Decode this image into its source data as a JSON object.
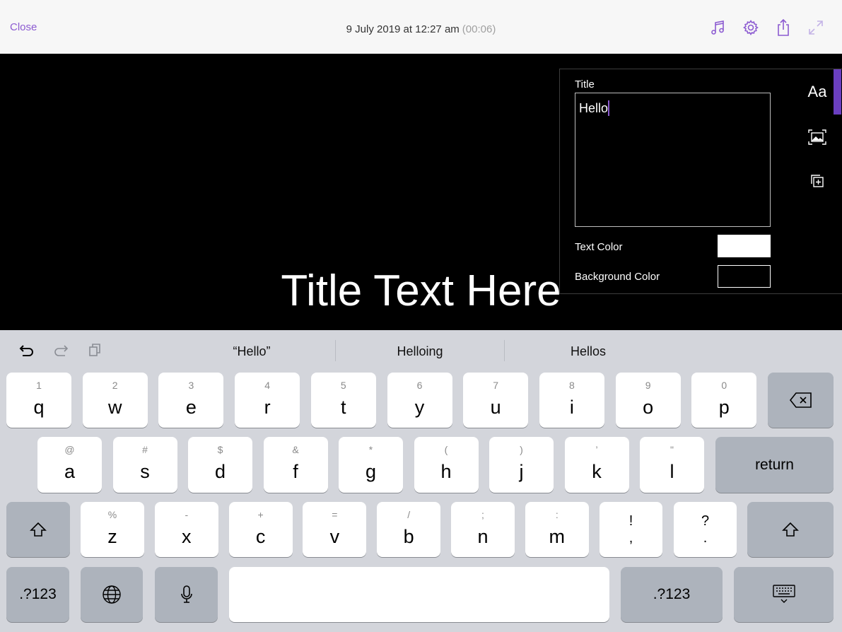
{
  "topbar": {
    "close_label": "Close",
    "timestamp": "9 July 2019 at 12:27 am",
    "duration": "(00:06)",
    "icons": [
      "music-icon",
      "gear-icon",
      "share-icon",
      "expand-icon"
    ]
  },
  "stage": {
    "title_text": "Title Text Here"
  },
  "panel": {
    "title_label": "Title",
    "title_value": "Hello",
    "text_color_label": "Text Color",
    "background_color_label": "Background Color",
    "text_color": "#ffffff",
    "background_color": "#000000",
    "tools": {
      "font_label": "Aa",
      "icons": [
        "font-icon",
        "image-frame-icon",
        "duplicate-add-icon"
      ]
    }
  },
  "keyboard": {
    "suggestions": [
      "“Hello”",
      "Helloing",
      "Hellos"
    ],
    "row1": [
      {
        "sub": "1",
        "main": "q"
      },
      {
        "sub": "2",
        "main": "w"
      },
      {
        "sub": "3",
        "main": "e"
      },
      {
        "sub": "4",
        "main": "r"
      },
      {
        "sub": "5",
        "main": "t"
      },
      {
        "sub": "6",
        "main": "y"
      },
      {
        "sub": "7",
        "main": "u"
      },
      {
        "sub": "8",
        "main": "i"
      },
      {
        "sub": "9",
        "main": "o"
      },
      {
        "sub": "0",
        "main": "p"
      }
    ],
    "row2": [
      {
        "sub": "@",
        "main": "a"
      },
      {
        "sub": "#",
        "main": "s"
      },
      {
        "sub": "$",
        "main": "d"
      },
      {
        "sub": "&",
        "main": "f"
      },
      {
        "sub": "*",
        "main": "g"
      },
      {
        "sub": "(",
        "main": "h"
      },
      {
        "sub": ")",
        "main": "j"
      },
      {
        "sub": "’",
        "main": "k"
      },
      {
        "sub": "\"",
        "main": "l"
      }
    ],
    "row3": [
      {
        "sub": "%",
        "main": "z"
      },
      {
        "sub": "-",
        "main": "x"
      },
      {
        "sub": "+",
        "main": "c"
      },
      {
        "sub": "=",
        "main": "v"
      },
      {
        "sub": "/",
        "main": "b"
      },
      {
        "sub": ";",
        "main": "n"
      },
      {
        "sub": ":",
        "main": "m"
      }
    ],
    "row3_punct": [
      {
        "top": "!",
        "bot": ","
      },
      {
        "top": "?",
        "bot": "."
      }
    ],
    "return_label": "return",
    "numbers_label": ".?123"
  }
}
